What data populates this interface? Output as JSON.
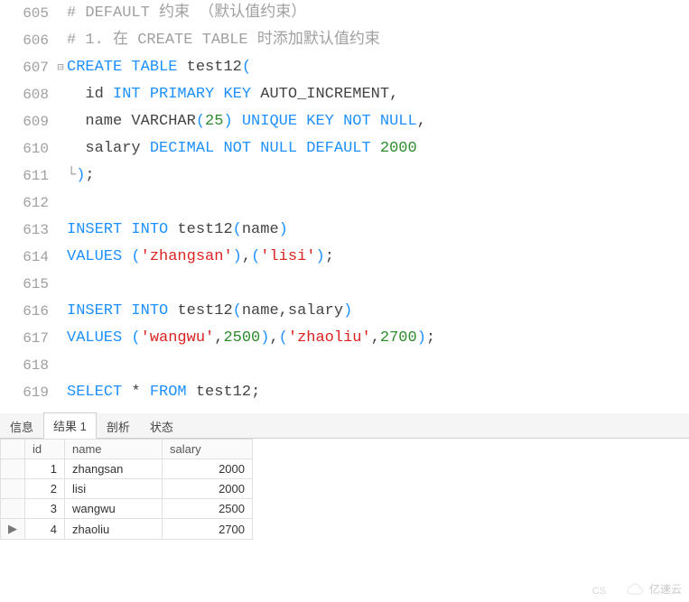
{
  "editor": {
    "lines": [
      {
        "num": "605",
        "fold": "",
        "tokens": [
          {
            "cls": "tok-comment",
            "t": "# DEFAULT 约束 （默认值约束）"
          }
        ]
      },
      {
        "num": "606",
        "fold": "",
        "tokens": [
          {
            "cls": "tok-comment",
            "t": "# 1. 在 CREATE TABLE 时添加默认值约束"
          }
        ]
      },
      {
        "num": "607",
        "fold": "⊟",
        "tokens": [
          {
            "cls": "tok-keyword",
            "t": "CREATE"
          },
          {
            "cls": "tok-plain",
            "t": " "
          },
          {
            "cls": "tok-keyword",
            "t": "TABLE"
          },
          {
            "cls": "tok-plain",
            "t": " "
          },
          {
            "cls": "tok-ident",
            "t": "test12"
          },
          {
            "cls": "tok-paren",
            "t": "("
          }
        ]
      },
      {
        "num": "608",
        "fold": "",
        "tokens": [
          {
            "cls": "tok-plain",
            "t": "  "
          },
          {
            "cls": "tok-ident",
            "t": "id"
          },
          {
            "cls": "tok-plain",
            "t": " "
          },
          {
            "cls": "tok-type",
            "t": "INT"
          },
          {
            "cls": "tok-plain",
            "t": " "
          },
          {
            "cls": "tok-keyword",
            "t": "PRIMARY"
          },
          {
            "cls": "tok-plain",
            "t": " "
          },
          {
            "cls": "tok-keyword",
            "t": "KEY"
          },
          {
            "cls": "tok-plain",
            "t": " "
          },
          {
            "cls": "tok-ident",
            "t": "AUTO_INCREMENT"
          },
          {
            "cls": "tok-punct",
            "t": ","
          }
        ]
      },
      {
        "num": "609",
        "fold": "",
        "tokens": [
          {
            "cls": "tok-plain",
            "t": "  "
          },
          {
            "cls": "tok-ident",
            "t": "name"
          },
          {
            "cls": "tok-plain",
            "t": " "
          },
          {
            "cls": "tok-ident",
            "t": "VARCHAR"
          },
          {
            "cls": "tok-paren",
            "t": "("
          },
          {
            "cls": "tok-number",
            "t": "25"
          },
          {
            "cls": "tok-paren",
            "t": ")"
          },
          {
            "cls": "tok-plain",
            "t": " "
          },
          {
            "cls": "tok-keyword",
            "t": "UNIQUE"
          },
          {
            "cls": "tok-plain",
            "t": " "
          },
          {
            "cls": "tok-keyword",
            "t": "KEY"
          },
          {
            "cls": "tok-plain",
            "t": " "
          },
          {
            "cls": "tok-keyword",
            "t": "NOT"
          },
          {
            "cls": "tok-plain",
            "t": " "
          },
          {
            "cls": "tok-keyword",
            "t": "NULL"
          },
          {
            "cls": "tok-punct",
            "t": ","
          }
        ]
      },
      {
        "num": "610",
        "fold": "",
        "tokens": [
          {
            "cls": "tok-plain",
            "t": "  "
          },
          {
            "cls": "tok-ident",
            "t": "salary"
          },
          {
            "cls": "tok-plain",
            "t": " "
          },
          {
            "cls": "tok-type",
            "t": "DECIMAL"
          },
          {
            "cls": "tok-plain",
            "t": " "
          },
          {
            "cls": "tok-keyword",
            "t": "NOT"
          },
          {
            "cls": "tok-plain",
            "t": " "
          },
          {
            "cls": "tok-keyword",
            "t": "NULL"
          },
          {
            "cls": "tok-plain",
            "t": " "
          },
          {
            "cls": "tok-keyword",
            "t": "DEFAULT"
          },
          {
            "cls": "tok-plain",
            "t": " "
          },
          {
            "cls": "tok-number",
            "t": "2000"
          }
        ]
      },
      {
        "num": "611",
        "fold": "",
        "tokens": [
          {
            "cls": "fold-brace",
            "t": "└"
          },
          {
            "cls": "tok-paren",
            "t": ")"
          },
          {
            "cls": "tok-punct",
            "t": ";"
          }
        ]
      },
      {
        "num": "612",
        "fold": "",
        "tokens": [
          {
            "cls": "tok-plain",
            "t": ""
          }
        ]
      },
      {
        "num": "613",
        "fold": "",
        "tokens": [
          {
            "cls": "tok-keyword",
            "t": "INSERT"
          },
          {
            "cls": "tok-plain",
            "t": " "
          },
          {
            "cls": "tok-keyword",
            "t": "INTO"
          },
          {
            "cls": "tok-plain",
            "t": " "
          },
          {
            "cls": "tok-ident",
            "t": "test12"
          },
          {
            "cls": "tok-paren",
            "t": "("
          },
          {
            "cls": "tok-ident",
            "t": "name"
          },
          {
            "cls": "tok-paren",
            "t": ")"
          }
        ]
      },
      {
        "num": "614",
        "fold": "",
        "tokens": [
          {
            "cls": "tok-keyword",
            "t": "VALUES"
          },
          {
            "cls": "tok-plain",
            "t": " "
          },
          {
            "cls": "tok-paren",
            "t": "("
          },
          {
            "cls": "tok-string",
            "t": "'zhangsan'"
          },
          {
            "cls": "tok-paren",
            "t": ")"
          },
          {
            "cls": "tok-punct",
            "t": ","
          },
          {
            "cls": "tok-paren",
            "t": "("
          },
          {
            "cls": "tok-string",
            "t": "'lisi'"
          },
          {
            "cls": "tok-paren",
            "t": ")"
          },
          {
            "cls": "tok-punct",
            "t": ";"
          }
        ]
      },
      {
        "num": "615",
        "fold": "",
        "tokens": [
          {
            "cls": "tok-plain",
            "t": ""
          }
        ]
      },
      {
        "num": "616",
        "fold": "",
        "tokens": [
          {
            "cls": "tok-keyword",
            "t": "INSERT"
          },
          {
            "cls": "tok-plain",
            "t": " "
          },
          {
            "cls": "tok-keyword",
            "t": "INTO"
          },
          {
            "cls": "tok-plain",
            "t": " "
          },
          {
            "cls": "tok-ident",
            "t": "test12"
          },
          {
            "cls": "tok-paren",
            "t": "("
          },
          {
            "cls": "tok-ident",
            "t": "name"
          },
          {
            "cls": "tok-punct",
            "t": ","
          },
          {
            "cls": "tok-ident",
            "t": "salary"
          },
          {
            "cls": "tok-paren",
            "t": ")"
          }
        ]
      },
      {
        "num": "617",
        "fold": "",
        "tokens": [
          {
            "cls": "tok-keyword",
            "t": "VALUES"
          },
          {
            "cls": "tok-plain",
            "t": " "
          },
          {
            "cls": "tok-paren",
            "t": "("
          },
          {
            "cls": "tok-string",
            "t": "'wangwu'"
          },
          {
            "cls": "tok-punct",
            "t": ","
          },
          {
            "cls": "tok-number",
            "t": "2500"
          },
          {
            "cls": "tok-paren",
            "t": ")"
          },
          {
            "cls": "tok-punct",
            "t": ","
          },
          {
            "cls": "tok-paren",
            "t": "("
          },
          {
            "cls": "tok-string",
            "t": "'zhaoliu'"
          },
          {
            "cls": "tok-punct",
            "t": ","
          },
          {
            "cls": "tok-number",
            "t": "2700"
          },
          {
            "cls": "tok-paren",
            "t": ")"
          },
          {
            "cls": "tok-punct",
            "t": ";"
          }
        ]
      },
      {
        "num": "618",
        "fold": "",
        "tokens": [
          {
            "cls": "tok-plain",
            "t": ""
          }
        ]
      },
      {
        "num": "619",
        "fold": "",
        "tokens": [
          {
            "cls": "tok-keyword",
            "t": "SELECT"
          },
          {
            "cls": "tok-plain",
            "t": " "
          },
          {
            "cls": "tok-punct",
            "t": "*"
          },
          {
            "cls": "tok-plain",
            "t": " "
          },
          {
            "cls": "tok-keyword",
            "t": "FROM"
          },
          {
            "cls": "tok-plain",
            "t": " "
          },
          {
            "cls": "tok-ident",
            "t": "test12"
          },
          {
            "cls": "tok-punct",
            "t": ";"
          }
        ]
      }
    ]
  },
  "tabs": {
    "items": [
      {
        "label": "信息",
        "active": false
      },
      {
        "label": "结果 1",
        "active": true
      },
      {
        "label": "剖析",
        "active": false
      },
      {
        "label": "状态",
        "active": false
      }
    ]
  },
  "result": {
    "columns": [
      "id",
      "name",
      "salary"
    ],
    "rows": [
      {
        "marker": "",
        "id": "1",
        "name": "zhangsan",
        "salary": "2000"
      },
      {
        "marker": "",
        "id": "2",
        "name": "lisi",
        "salary": "2000"
      },
      {
        "marker": "",
        "id": "3",
        "name": "wangwu",
        "salary": "2500"
      },
      {
        "marker": "▶",
        "id": "4",
        "name": "zhaoliu",
        "salary": "2700"
      }
    ]
  },
  "watermark": {
    "text": "亿速云",
    "cs": "CS"
  }
}
